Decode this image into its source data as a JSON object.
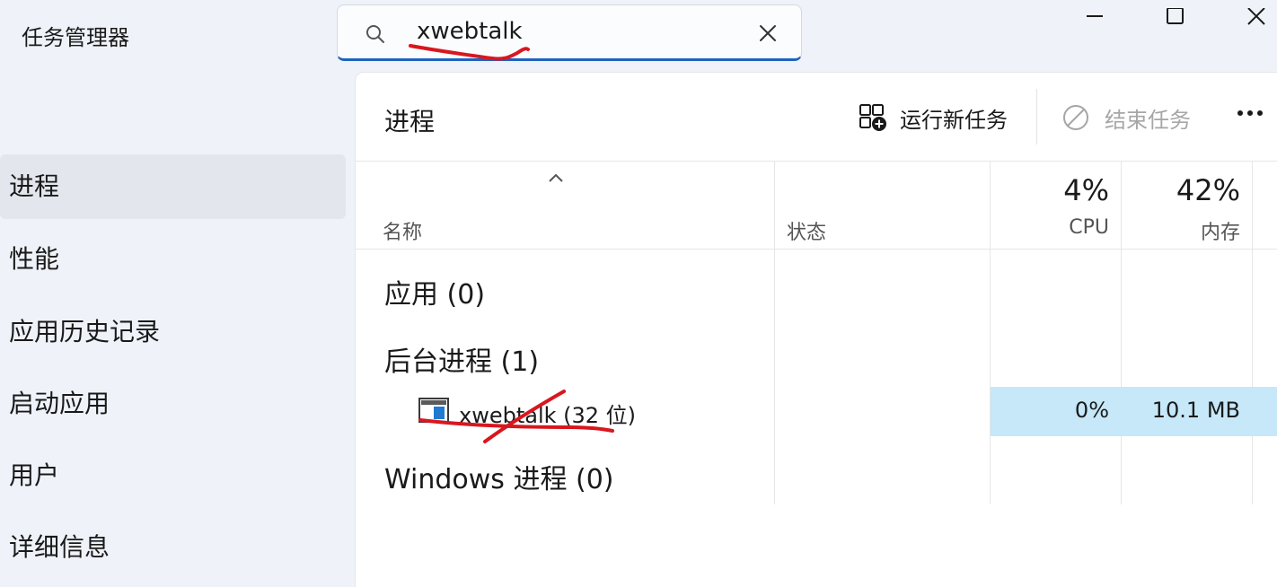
{
  "app": {
    "title": "任务管理器"
  },
  "search": {
    "value": "xwebtalk"
  },
  "nav": {
    "items": [
      {
        "label": "进程"
      },
      {
        "label": "性能"
      },
      {
        "label": "应用历史记录"
      },
      {
        "label": "启动应用"
      },
      {
        "label": "用户"
      },
      {
        "label": "详细信息"
      }
    ]
  },
  "toolbar": {
    "title": "进程",
    "run_new_task": "运行新任务",
    "end_task": "结束任务"
  },
  "table": {
    "columns": {
      "name": "名称",
      "status": "状态",
      "cpu_total": "4%",
      "cpu": "CPU",
      "memory_total": "42%",
      "memory": "内存"
    },
    "groups": {
      "apps": "应用 (0)",
      "background": "后台进程 (1)",
      "windows": "Windows 进程 (0)"
    },
    "rows": [
      {
        "name": "xwebtalk (32 位)",
        "cpu": "0%",
        "memory": "10.1 MB"
      }
    ]
  },
  "colors": {
    "accent": "#1f63c0",
    "row_highlight": "#c6e8f8",
    "annotation": "#d8171e"
  }
}
